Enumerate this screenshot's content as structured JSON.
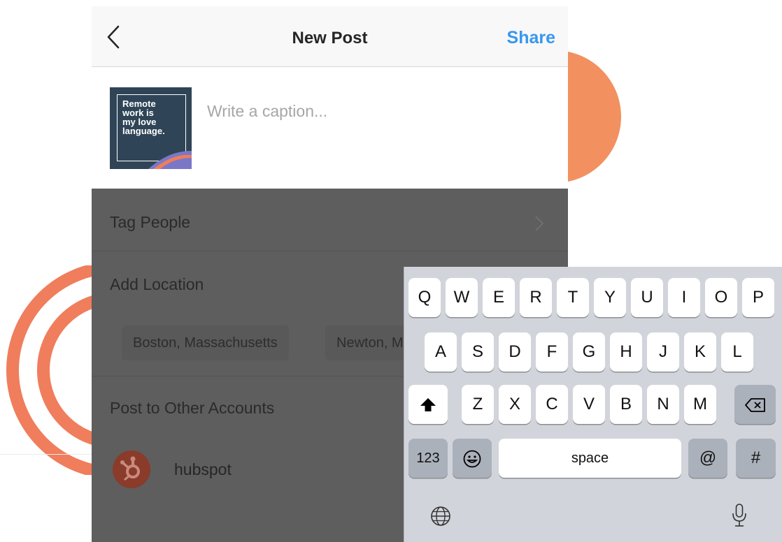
{
  "nav": {
    "back_icon": "chevron-left-icon",
    "title": "New Post",
    "share_label": "Share"
  },
  "thumbnail": {
    "text": "Remote\nwork is\nmy love\nlanguage."
  },
  "caption": {
    "placeholder": "Write a caption..."
  },
  "options": {
    "tag_people": "Tag People",
    "add_location": "Add Location",
    "location_suggestions": [
      "Boston, Massachusetts",
      "Newton, M"
    ],
    "post_to_other": "Post to Other Accounts",
    "account": {
      "name": "hubspot",
      "icon": "hubspot-logo-icon"
    }
  },
  "keyboard": {
    "row1": [
      "Q",
      "W",
      "E",
      "R",
      "T",
      "Y",
      "U",
      "I",
      "O",
      "P"
    ],
    "row2": [
      "A",
      "S",
      "D",
      "F",
      "G",
      "H",
      "J",
      "K",
      "L"
    ],
    "row3": [
      "Z",
      "X",
      "C",
      "V",
      "B",
      "N",
      "M"
    ],
    "numbers_label": "123",
    "space_label": "space",
    "at_label": "@",
    "hash_label": "#",
    "icons": [
      "shift-icon",
      "backspace-icon",
      "emoji-icon",
      "globe-icon",
      "microphone-icon"
    ]
  },
  "colors": {
    "accent": "#3897f0",
    "decoration": "#f39060",
    "hubspot": "#ff7a59"
  }
}
